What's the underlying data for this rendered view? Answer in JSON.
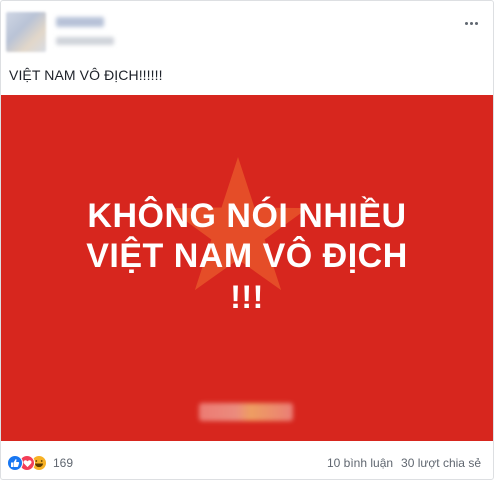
{
  "post": {
    "text": "VIỆT NAM VÔ ĐỊCH!!!!!!",
    "image": {
      "lines": [
        "KHÔNG NÓI NHIỀU",
        "VIỆT NAM VÔ ĐỊCH",
        "!!!"
      ],
      "background_color": "#d7261e",
      "star_color": "#e8572a"
    }
  },
  "footer": {
    "reaction_icons": [
      "like-icon",
      "love-icon",
      "haha-icon"
    ],
    "reaction_count": "169",
    "comments": "10 bình luận",
    "shares": "30 lượt chia sẻ"
  }
}
